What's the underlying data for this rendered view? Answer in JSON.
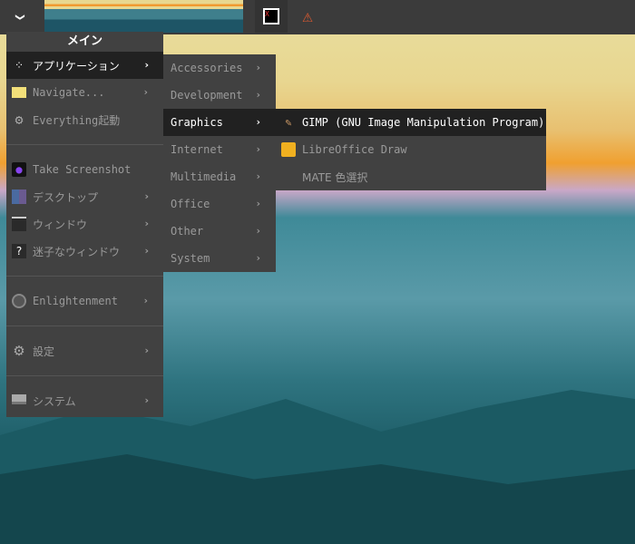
{
  "topbar": {
    "menu_toggle": "❯",
    "tray_terminal": "X",
    "tray_warning": "⚠"
  },
  "main_menu": {
    "title": "メイン",
    "items": [
      {
        "label": "アプリケーション",
        "icon": "applications-icon"
      },
      {
        "label": "Navigate...",
        "icon": "folder-icon"
      },
      {
        "label": "Everything起動",
        "icon": "gear-icon"
      },
      {
        "label": "Take Screenshot",
        "icon": "camera-icon"
      },
      {
        "label": "デスクトップ",
        "icon": "desktop-icon"
      },
      {
        "label": "ウィンドウ",
        "icon": "window-icon"
      },
      {
        "label": "迷子なウィンドウ",
        "icon": "lost-window-icon"
      },
      {
        "label": "Enlightenment",
        "icon": "enlightenment-icon"
      },
      {
        "label": "設定",
        "icon": "settings-icon"
      },
      {
        "label": "システム",
        "icon": "computer-icon"
      }
    ]
  },
  "apps_menu": {
    "items": [
      "Accessories",
      "Development",
      "Graphics",
      "Internet",
      "Multimedia",
      "Office",
      "Other",
      "System"
    ]
  },
  "graphics_menu": {
    "items": [
      "GIMP (GNU Image Manipulation Program)",
      "LibreOffice Draw",
      "MATE 色選択"
    ]
  }
}
